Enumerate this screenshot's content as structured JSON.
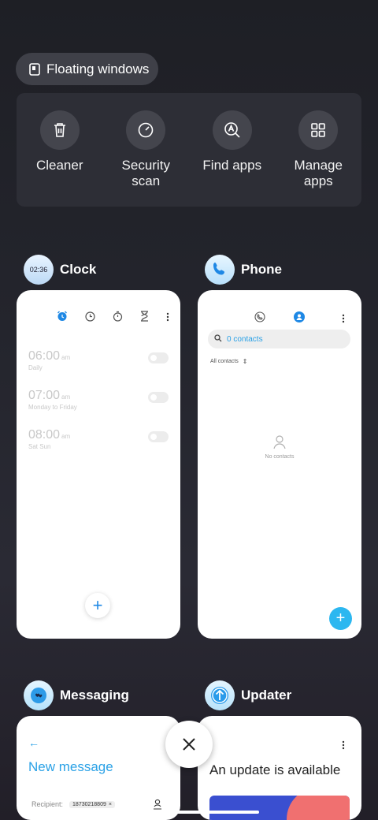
{
  "floating_windows": {
    "label": "Floating windows",
    "icon": "floating-window-icon"
  },
  "tools": [
    {
      "label": "Cleaner",
      "icon": "trash-icon"
    },
    {
      "label": "Security\nscan",
      "icon": "security-scan-icon"
    },
    {
      "label": "Find apps",
      "icon": "find-apps-icon"
    },
    {
      "label": "Manage\napps",
      "icon": "grid-icon"
    }
  ],
  "apps": {
    "clock": {
      "title": "Clock",
      "icon_text": "02:36",
      "alarms": [
        {
          "time": "06:00",
          "ampm": "am",
          "repeat": "Daily"
        },
        {
          "time": "07:00",
          "ampm": "am",
          "repeat": "Monday to Friday"
        },
        {
          "time": "08:00",
          "ampm": "am",
          "repeat": "Sat Sun"
        }
      ],
      "fab": "+"
    },
    "phone": {
      "title": "Phone",
      "search_placeholder": "0 contacts",
      "filter": "All contacts",
      "empty": "No contacts",
      "fab": "+"
    },
    "messaging": {
      "title": "Messaging",
      "heading": "New message",
      "recipient_label": "Recipient:",
      "recipient_chip": "18730218809",
      "chip_close": "×"
    },
    "updater": {
      "title": "Updater",
      "heading": "An update is available"
    }
  },
  "colors": {
    "accent_blue": "#2aa1e6",
    "fab_blue": "#2cb7f0",
    "background": "#1e1f25"
  }
}
